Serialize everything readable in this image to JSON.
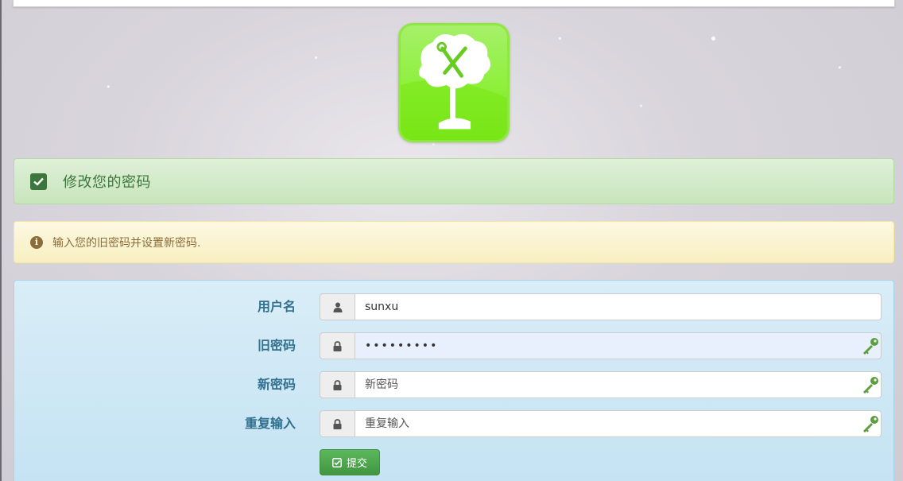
{
  "header": {
    "title": "修改您的密码"
  },
  "notice": {
    "text": "输入您的旧密码并设置新密码."
  },
  "form": {
    "username": {
      "label": "用户名",
      "value": "sunxu"
    },
    "old_password": {
      "label": "旧密码",
      "value": "•••••••••"
    },
    "new_password": {
      "label": "新密码",
      "placeholder": "新密码"
    },
    "repeat_password": {
      "label": "重复输入",
      "placeholder": "重复输入"
    },
    "submit_label": "提交"
  },
  "icons": {
    "logo": "tree-tools-logo-icon",
    "header": "check-square-icon",
    "notice": "info-circle-icon",
    "user": "user-icon",
    "lock": "lock-icon",
    "key": "key-icon",
    "submit": "check-square-icon"
  },
  "colors": {
    "success_text": "#3c763d",
    "warning_text": "#8a6d3b",
    "info_label": "#31708f",
    "button": "#5cb85c",
    "key": "#5a9e3e"
  }
}
